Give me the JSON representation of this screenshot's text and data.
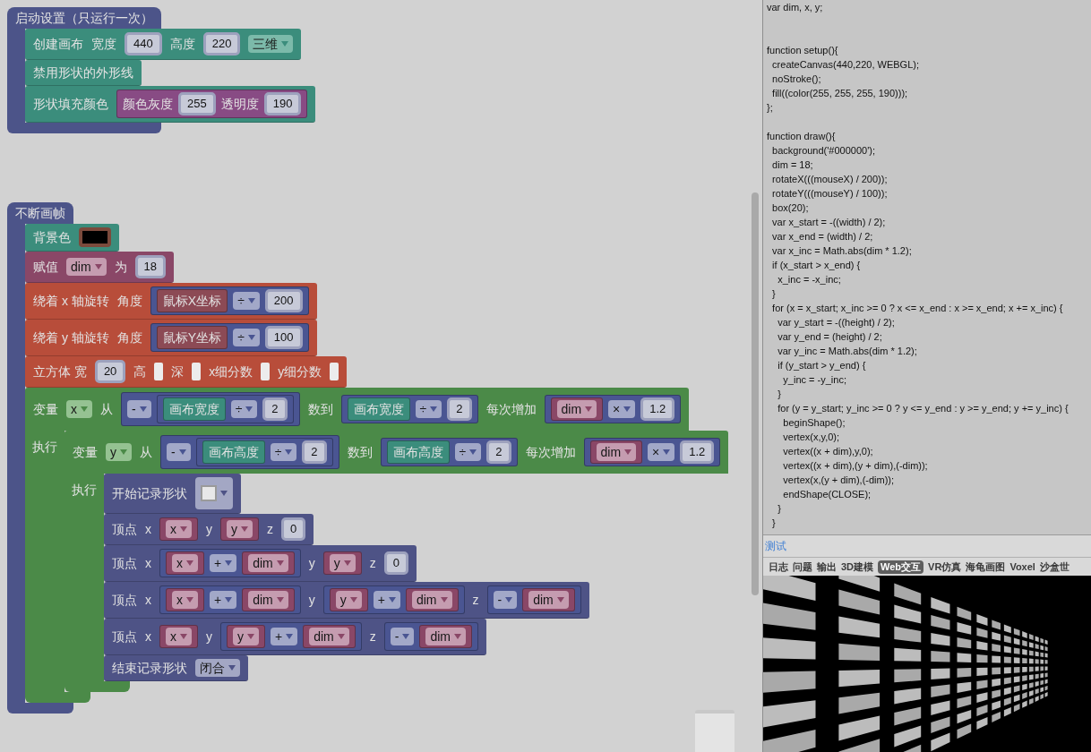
{
  "workspace": {
    "stacks": [
      {
        "kind": "event",
        "line": [
          {
            "kind": "label",
            "text": "启动设置（只运行一次）"
          }
        ],
        "branches": [
          {
            "body": [
              {
                "kind": "canvas",
                "line": [
                  {
                    "kind": "label",
                    "text": "创建画布"
                  },
                  {
                    "kind": "label",
                    "text": "宽度"
                  },
                  {
                    "kind": "number",
                    "text": "440"
                  },
                  {
                    "kind": "label",
                    "text": "高度"
                  },
                  {
                    "kind": "number",
                    "text": "220"
                  },
                  {
                    "kind": "dropdown",
                    "text": "三维"
                  }
                ]
              },
              {
                "kind": "canvas",
                "line": [
                  {
                    "kind": "label",
                    "text": "禁用形状的外形线"
                  }
                ]
              },
              {
                "kind": "canvas",
                "line": [
                  {
                    "kind": "label",
                    "text": "形状填充颜色"
                  },
                  {
                    "kind": "block",
                    "block": {
                      "kind": "color",
                      "line": [
                        {
                          "kind": "label",
                          "text": "颜色灰度"
                        },
                        {
                          "kind": "number",
                          "text": "255"
                        },
                        {
                          "kind": "label",
                          "text": "透明度"
                        },
                        {
                          "kind": "number",
                          "text": "190"
                        }
                      ]
                    }
                  }
                ]
              }
            ]
          }
        ]
      },
      {
        "kind": "event",
        "line": [
          {
            "kind": "label",
            "text": "不断画帧"
          }
        ],
        "branches": [
          {
            "body": [
              {
                "kind": "canvas",
                "line": [
                  {
                    "kind": "label",
                    "text": "背景色"
                  },
                  {
                    "kind": "swatch",
                    "color": "#000000"
                  }
                ]
              },
              {
                "kind": "variable",
                "line": [
                  {
                    "kind": "label",
                    "text": "赋值"
                  },
                  {
                    "kind": "dropdown",
                    "text": "dim"
                  },
                  {
                    "kind": "label",
                    "text": "为"
                  },
                  {
                    "kind": "number",
                    "text": "18"
                  }
                ]
              },
              {
                "kind": "transform",
                "line": [
                  {
                    "kind": "label",
                    "text": "绕着 x 轴旋转"
                  },
                  {
                    "kind": "label",
                    "text": "角度"
                  },
                  {
                    "kind": "block",
                    "block": {
                      "kind": "math",
                      "line": [
                        {
                          "kind": "block",
                          "block": {
                            "kind": "sensor",
                            "line": [
                              {
                                "kind": "label",
                                "text": "鼠标X坐标"
                              }
                            ]
                          }
                        },
                        {
                          "kind": "dropdown",
                          "text": "÷"
                        },
                        {
                          "kind": "number",
                          "text": "200"
                        }
                      ]
                    }
                  }
                ]
              },
              {
                "kind": "transform",
                "line": [
                  {
                    "kind": "label",
                    "text": "绕着 y 轴旋转"
                  },
                  {
                    "kind": "label",
                    "text": "角度"
                  },
                  {
                    "kind": "block",
                    "block": {
                      "kind": "math",
                      "line": [
                        {
                          "kind": "block",
                          "block": {
                            "kind": "sensor",
                            "line": [
                              {
                                "kind": "label",
                                "text": "鼠标Y坐标"
                              }
                            ]
                          }
                        },
                        {
                          "kind": "dropdown",
                          "text": "÷"
                        },
                        {
                          "kind": "number",
                          "text": "100"
                        }
                      ]
                    }
                  }
                ]
              },
              {
                "kind": "transform",
                "line": [
                  {
                    "kind": "label",
                    "text": "立方体 宽"
                  },
                  {
                    "kind": "number",
                    "text": "20"
                  },
                  {
                    "kind": "label",
                    "text": "高"
                  },
                  {
                    "kind": "empty"
                  },
                  {
                    "kind": "label",
                    "text": "深"
                  },
                  {
                    "kind": "empty"
                  },
                  {
                    "kind": "label",
                    "text": "x细分数"
                  },
                  {
                    "kind": "empty"
                  },
                  {
                    "kind": "label",
                    "text": "y细分数"
                  },
                  {
                    "kind": "empty"
                  }
                ]
              },
              {
                "kind": "loop",
                "line": [
                  {
                    "kind": "label",
                    "text": "变量"
                  },
                  {
                    "kind": "dropdown",
                    "text": "x"
                  },
                  {
                    "kind": "label",
                    "text": "从"
                  },
                  {
                    "kind": "block",
                    "block": {
                      "kind": "math",
                      "line": [
                        {
                          "kind": "dropdown",
                          "text": "-"
                        },
                        {
                          "kind": "block",
                          "block": {
                            "kind": "math",
                            "line": [
                              {
                                "kind": "block",
                                "block": {
                                  "kind": "canvas",
                                  "line": [
                                    {
                                      "kind": "label",
                                      "text": "画布宽度"
                                    }
                                  ]
                                }
                              },
                              {
                                "kind": "dropdown",
                                "text": "÷"
                              },
                              {
                                "kind": "number",
                                "text": "2"
                              }
                            ]
                          }
                        }
                      ]
                    }
                  },
                  {
                    "kind": "label",
                    "text": "数到"
                  },
                  {
                    "kind": "block",
                    "block": {
                      "kind": "math",
                      "line": [
                        {
                          "kind": "block",
                          "block": {
                            "kind": "canvas",
                            "line": [
                              {
                                "kind": "label",
                                "text": "画布宽度"
                              }
                            ]
                          }
                        },
                        {
                          "kind": "dropdown",
                          "text": "÷"
                        },
                        {
                          "kind": "number",
                          "text": "2"
                        }
                      ]
                    }
                  },
                  {
                    "kind": "label",
                    "text": "每次增加"
                  },
                  {
                    "kind": "block",
                    "block": {
                      "kind": "math",
                      "line": [
                        {
                          "kind": "block",
                          "block": {
                            "kind": "variable",
                            "line": [
                              {
                                "kind": "dropdown",
                                "text": "dim"
                              }
                            ]
                          }
                        },
                        {
                          "kind": "dropdown",
                          "text": "×"
                        },
                        {
                          "kind": "number",
                          "text": "1.2"
                        }
                      ]
                    }
                  }
                ],
                "branches": [
                  {
                    "label": "执行",
                    "body": [
                      {
                        "kind": "loop",
                        "line": [
                          {
                            "kind": "label",
                            "text": "变量"
                          },
                          {
                            "kind": "dropdown",
                            "text": "y"
                          },
                          {
                            "kind": "label",
                            "text": "从"
                          },
                          {
                            "kind": "block",
                            "block": {
                              "kind": "math",
                              "line": [
                                {
                                  "kind": "dropdown",
                                  "text": "-"
                                },
                                {
                                  "kind": "block",
                                  "block": {
                                    "kind": "math",
                                    "line": [
                                      {
                                        "kind": "block",
                                        "block": {
                                          "kind": "canvas",
                                          "line": [
                                            {
                                              "kind": "label",
                                              "text": "画布高度"
                                            }
                                          ]
                                        }
                                      },
                                      {
                                        "kind": "dropdown",
                                        "text": "÷"
                                      },
                                      {
                                        "kind": "number",
                                        "text": "2"
                                      }
                                    ]
                                  }
                                }
                              ]
                            }
                          },
                          {
                            "kind": "label",
                            "text": "数到"
                          },
                          {
                            "kind": "block",
                            "block": {
                              "kind": "math",
                              "line": [
                                {
                                  "kind": "block",
                                  "block": {
                                    "kind": "canvas",
                                    "line": [
                                      {
                                        "kind": "label",
                                        "text": "画布高度"
                                      }
                                    ]
                                  }
                                },
                                {
                                  "kind": "dropdown",
                                  "text": "÷"
                                },
                                {
                                  "kind": "number",
                                  "text": "2"
                                }
                              ]
                            }
                          },
                          {
                            "kind": "label",
                            "text": "每次增加"
                          },
                          {
                            "kind": "block",
                            "block": {
                              "kind": "math",
                              "line": [
                                {
                                  "kind": "block",
                                  "block": {
                                    "kind": "variable",
                                    "line": [
                                      {
                                        "kind": "dropdown",
                                        "text": "dim"
                                      }
                                    ]
                                  }
                                },
                                {
                                  "kind": "dropdown",
                                  "text": "×"
                                },
                                {
                                  "kind": "number",
                                  "text": "1.2"
                                }
                              ]
                            }
                          }
                        ],
                        "branches": [
                          {
                            "label": "执行",
                            "body": [
                              {
                                "kind": "shape",
                                "line": [
                                  {
                                    "kind": "label",
                                    "text": "开始记录形状"
                                  },
                                  {
                                    "kind": "image_dropdown"
                                  }
                                ]
                              },
                              {
                                "kind": "shape",
                                "line": [
                                  {
                                    "kind": "label",
                                    "text": "顶点"
                                  },
                                  {
                                    "kind": "label",
                                    "text": "x"
                                  },
                                  {
                                    "kind": "block",
                                    "block": {
                                      "kind": "variable",
                                      "line": [
                                        {
                                          "kind": "dropdown",
                                          "text": "x"
                                        }
                                      ]
                                    }
                                  },
                                  {
                                    "kind": "label",
                                    "text": "y"
                                  },
                                  {
                                    "kind": "block",
                                    "block": {
                                      "kind": "variable",
                                      "line": [
                                        {
                                          "kind": "dropdown",
                                          "text": "y"
                                        }
                                      ]
                                    }
                                  },
                                  {
                                    "kind": "label",
                                    "text": "z"
                                  },
                                  {
                                    "kind": "number",
                                    "text": "0"
                                  }
                                ]
                              },
                              {
                                "kind": "shape",
                                "line": [
                                  {
                                    "kind": "label",
                                    "text": "顶点"
                                  },
                                  {
                                    "kind": "label",
                                    "text": "x"
                                  },
                                  {
                                    "kind": "block",
                                    "block": {
                                      "kind": "math",
                                      "line": [
                                        {
                                          "kind": "block",
                                          "block": {
                                            "kind": "variable",
                                            "line": [
                                              {
                                                "kind": "dropdown",
                                                "text": "x"
                                              }
                                            ]
                                          }
                                        },
                                        {
                                          "kind": "dropdown",
                                          "text": "+"
                                        },
                                        {
                                          "kind": "block",
                                          "block": {
                                            "kind": "variable",
                                            "line": [
                                              {
                                                "kind": "dropdown",
                                                "text": "dim"
                                              }
                                            ]
                                          }
                                        }
                                      ]
                                    }
                                  },
                                  {
                                    "kind": "label",
                                    "text": "y"
                                  },
                                  {
                                    "kind": "block",
                                    "block": {
                                      "kind": "variable",
                                      "line": [
                                        {
                                          "kind": "dropdown",
                                          "text": "y"
                                        }
                                      ]
                                    }
                                  },
                                  {
                                    "kind": "label",
                                    "text": "z"
                                  },
                                  {
                                    "kind": "number",
                                    "text": "0"
                                  }
                                ]
                              },
                              {
                                "kind": "shape",
                                "line": [
                                  {
                                    "kind": "label",
                                    "text": "顶点"
                                  },
                                  {
                                    "kind": "label",
                                    "text": "x"
                                  },
                                  {
                                    "kind": "block",
                                    "block": {
                                      "kind": "math",
                                      "line": [
                                        {
                                          "kind": "block",
                                          "block": {
                                            "kind": "variable",
                                            "line": [
                                              {
                                                "kind": "dropdown",
                                                "text": "x"
                                              }
                                            ]
                                          }
                                        },
                                        {
                                          "kind": "dropdown",
                                          "text": "+"
                                        },
                                        {
                                          "kind": "block",
                                          "block": {
                                            "kind": "variable",
                                            "line": [
                                              {
                                                "kind": "dropdown",
                                                "text": "dim"
                                              }
                                            ]
                                          }
                                        }
                                      ]
                                    }
                                  },
                                  {
                                    "kind": "label",
                                    "text": "y"
                                  },
                                  {
                                    "kind": "block",
                                    "block": {
                                      "kind": "math",
                                      "line": [
                                        {
                                          "kind": "block",
                                          "block": {
                                            "kind": "variable",
                                            "line": [
                                              {
                                                "kind": "dropdown",
                                                "text": "y"
                                              }
                                            ]
                                          }
                                        },
                                        {
                                          "kind": "dropdown",
                                          "text": "+"
                                        },
                                        {
                                          "kind": "block",
                                          "block": {
                                            "kind": "variable",
                                            "line": [
                                              {
                                                "kind": "dropdown",
                                                "text": "dim"
                                              }
                                            ]
                                          }
                                        }
                                      ]
                                    }
                                  },
                                  {
                                    "kind": "label",
                                    "text": "z"
                                  },
                                  {
                                    "kind": "block",
                                    "block": {
                                      "kind": "math",
                                      "line": [
                                        {
                                          "kind": "dropdown",
                                          "text": "-"
                                        },
                                        {
                                          "kind": "block",
                                          "block": {
                                            "kind": "variable",
                                            "line": [
                                              {
                                                "kind": "dropdown",
                                                "text": "dim"
                                              }
                                            ]
                                          }
                                        }
                                      ]
                                    }
                                  }
                                ]
                              },
                              {
                                "kind": "shape",
                                "line": [
                                  {
                                    "kind": "label",
                                    "text": "顶点"
                                  },
                                  {
                                    "kind": "label",
                                    "text": "x"
                                  },
                                  {
                                    "kind": "block",
                                    "block": {
                                      "kind": "variable",
                                      "line": [
                                        {
                                          "kind": "dropdown",
                                          "text": "x"
                                        }
                                      ]
                                    }
                                  },
                                  {
                                    "kind": "label",
                                    "text": "y"
                                  },
                                  {
                                    "kind": "block",
                                    "block": {
                                      "kind": "math",
                                      "line": [
                                        {
                                          "kind": "block",
                                          "block": {
                                            "kind": "variable",
                                            "line": [
                                              {
                                                "kind": "dropdown",
                                                "text": "y"
                                              }
                                            ]
                                          }
                                        },
                                        {
                                          "kind": "dropdown",
                                          "text": "+"
                                        },
                                        {
                                          "kind": "block",
                                          "block": {
                                            "kind": "variable",
                                            "line": [
                                              {
                                                "kind": "dropdown",
                                                "text": "dim"
                                              }
                                            ]
                                          }
                                        }
                                      ]
                                    }
                                  },
                                  {
                                    "kind": "label",
                                    "text": "z"
                                  },
                                  {
                                    "kind": "block",
                                    "block": {
                                      "kind": "math",
                                      "line": [
                                        {
                                          "kind": "dropdown",
                                          "text": "-"
                                        },
                                        {
                                          "kind": "block",
                                          "block": {
                                            "kind": "variable",
                                            "line": [
                                              {
                                                "kind": "dropdown",
                                                "text": "dim"
                                              }
                                            ]
                                          }
                                        }
                                      ]
                                    }
                                  }
                                ]
                              },
                              {
                                "kind": "shape",
                                "line": [
                                  {
                                    "kind": "label",
                                    "text": "结束记录形状"
                                  },
                                  {
                                    "kind": "dropdown",
                                    "text": "闭合"
                                  }
                                ]
                              }
                            ]
                          }
                        ]
                      }
                    ]
                  }
                ]
              }
            ]
          }
        ]
      }
    ]
  },
  "code": {
    "groups": [
      [
        "var dim, x, y;"
      ],
      [
        "function setup(){",
        "  createCanvas(440,220, WEBGL);",
        "  noStroke();",
        "  fill((color(255, 255, 255, 190)));",
        "};"
      ],
      [
        "function draw(){",
        "  background('#000000');",
        "  dim = 18;",
        "  rotateX(((mouseX) / 200));",
        "  rotateY(((mouseY) / 100));",
        "  box(20);",
        "  var x_start = -((width) / 2);",
        "  var x_end = (width) / 2;",
        "  var x_inc = Math.abs(dim * 1.2);",
        "  if (x_start > x_end) {",
        "    x_inc = -x_inc;",
        "  }",
        "  for (x = x_start; x_inc >= 0 ? x <= x_end : x >= x_end; x += x_inc) {",
        "    var y_start = -((height) / 2);",
        "    var y_end = (height) / 2;",
        "    var y_inc = Math.abs(dim * 1.2);",
        "    if (y_start > y_end) {",
        "      y_inc = -y_inc;",
        "    }",
        "    for (y = y_start; y_inc >= 0 ? y <= y_end : y >= y_end; y += y_inc) {",
        "      beginShape();",
        "      vertex(x,y,0);",
        "      vertex((x + dim),y,0);",
        "      vertex((x + dim),(y + dim),(-dim));",
        "      vertex(x,(y + dim),(-dim));",
        "      endShape(CLOSE);",
        "    }",
        "  }"
      ]
    ]
  },
  "test_label": "测试",
  "tabs": [
    {
      "label": "日志",
      "selected": false
    },
    {
      "label": "问题",
      "selected": false
    },
    {
      "label": "输出",
      "selected": false
    },
    {
      "label": "3D建模",
      "selected": false
    },
    {
      "label": "Web交互",
      "selected": true
    },
    {
      "label": "VR仿真",
      "selected": false
    },
    {
      "label": "海龟画图",
      "selected": false
    },
    {
      "label": "Voxel",
      "selected": false
    },
    {
      "label": "沙盒世",
      "selected": false
    }
  ]
}
